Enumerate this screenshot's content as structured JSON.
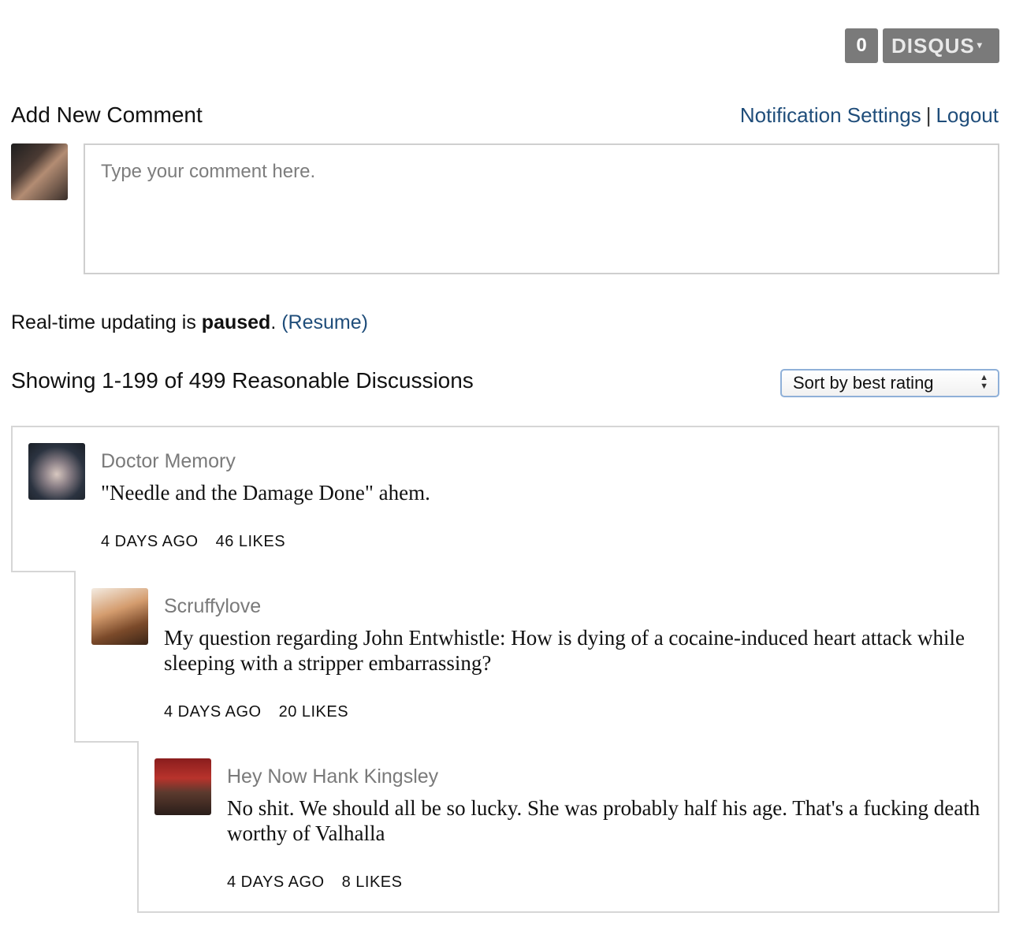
{
  "header": {
    "comment_count": "0",
    "brand": "DISQUS",
    "brand_caret": "▾"
  },
  "composer": {
    "title": "Add New Comment",
    "notification_settings": "Notification Settings",
    "separator": "|",
    "logout": "Logout",
    "placeholder": "Type your comment here."
  },
  "realtime": {
    "prefix": "Real-time updating is ",
    "status": "paused",
    "suffix": ". ",
    "resume": "(Resume)"
  },
  "listing": {
    "showing": "Showing 1-199 of 499 Reasonable Discussions",
    "sort_selected": "Sort by best rating"
  },
  "comments": [
    {
      "author": "Doctor Memory",
      "text": "\"Needle and the Damage Done\" ahem.",
      "age": "4 DAYS AGO",
      "likes": "46 LIKES"
    },
    {
      "author": "Scruffylove",
      "text": "My question regarding John Entwhistle: How is dying of a cocaine-induced heart attack while sleeping with a stripper embarrassing?",
      "age": "4 DAYS AGO",
      "likes": "20 LIKES"
    },
    {
      "author": "Hey Now Hank Kingsley",
      "text": "No shit. We should all be so lucky. She was probably half his age. That's a fucking death worthy of Valhalla",
      "age": "4 DAYS AGO",
      "likes": "8 LIKES"
    }
  ]
}
